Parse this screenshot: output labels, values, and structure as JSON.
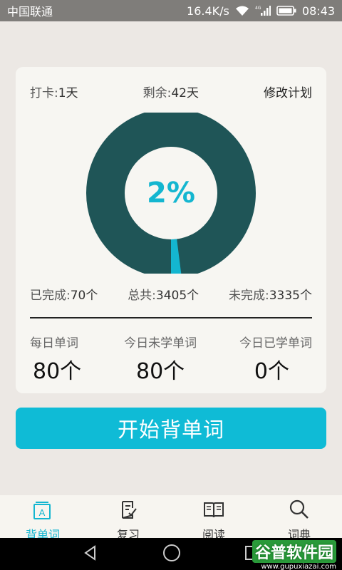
{
  "status_bar": {
    "carrier": "中国联通",
    "speed": "16.4K/s",
    "network": "4G",
    "time": "08:43"
  },
  "plan": {
    "checkin_label": "打卡:",
    "checkin_value": "1天",
    "remaining_label": "剩余:",
    "remaining_value": "42天",
    "edit_label": "修改计划"
  },
  "progress": {
    "percent_text": "2%",
    "fraction": 0.02,
    "ring_color": "#1f5557",
    "accent_color": "#14b6d0"
  },
  "stats": {
    "done_label": "已完成:",
    "done_value": "70个",
    "total_label": "总共:",
    "total_value": "3405个",
    "left_label": "未完成:",
    "left_value": "3335个"
  },
  "summary": {
    "daily_label": "每日单词",
    "daily_value": "80个",
    "unlearned_label": "今日未学单词",
    "unlearned_value": "80个",
    "learned_label": "今日已学单词",
    "learned_value": "0个"
  },
  "start_button": {
    "label": "开始背单词"
  },
  "tabs": [
    {
      "label": "背单词",
      "icon": "card-a-icon",
      "active": true
    },
    {
      "label": "复习",
      "icon": "note-check-icon",
      "active": false
    },
    {
      "label": "阅读",
      "icon": "book-icon",
      "active": false
    },
    {
      "label": "词典",
      "icon": "magnifier-icon",
      "active": false
    }
  ],
  "watermark": {
    "brand": "谷普软件园",
    "url": "www.gupuxiazai.com"
  }
}
